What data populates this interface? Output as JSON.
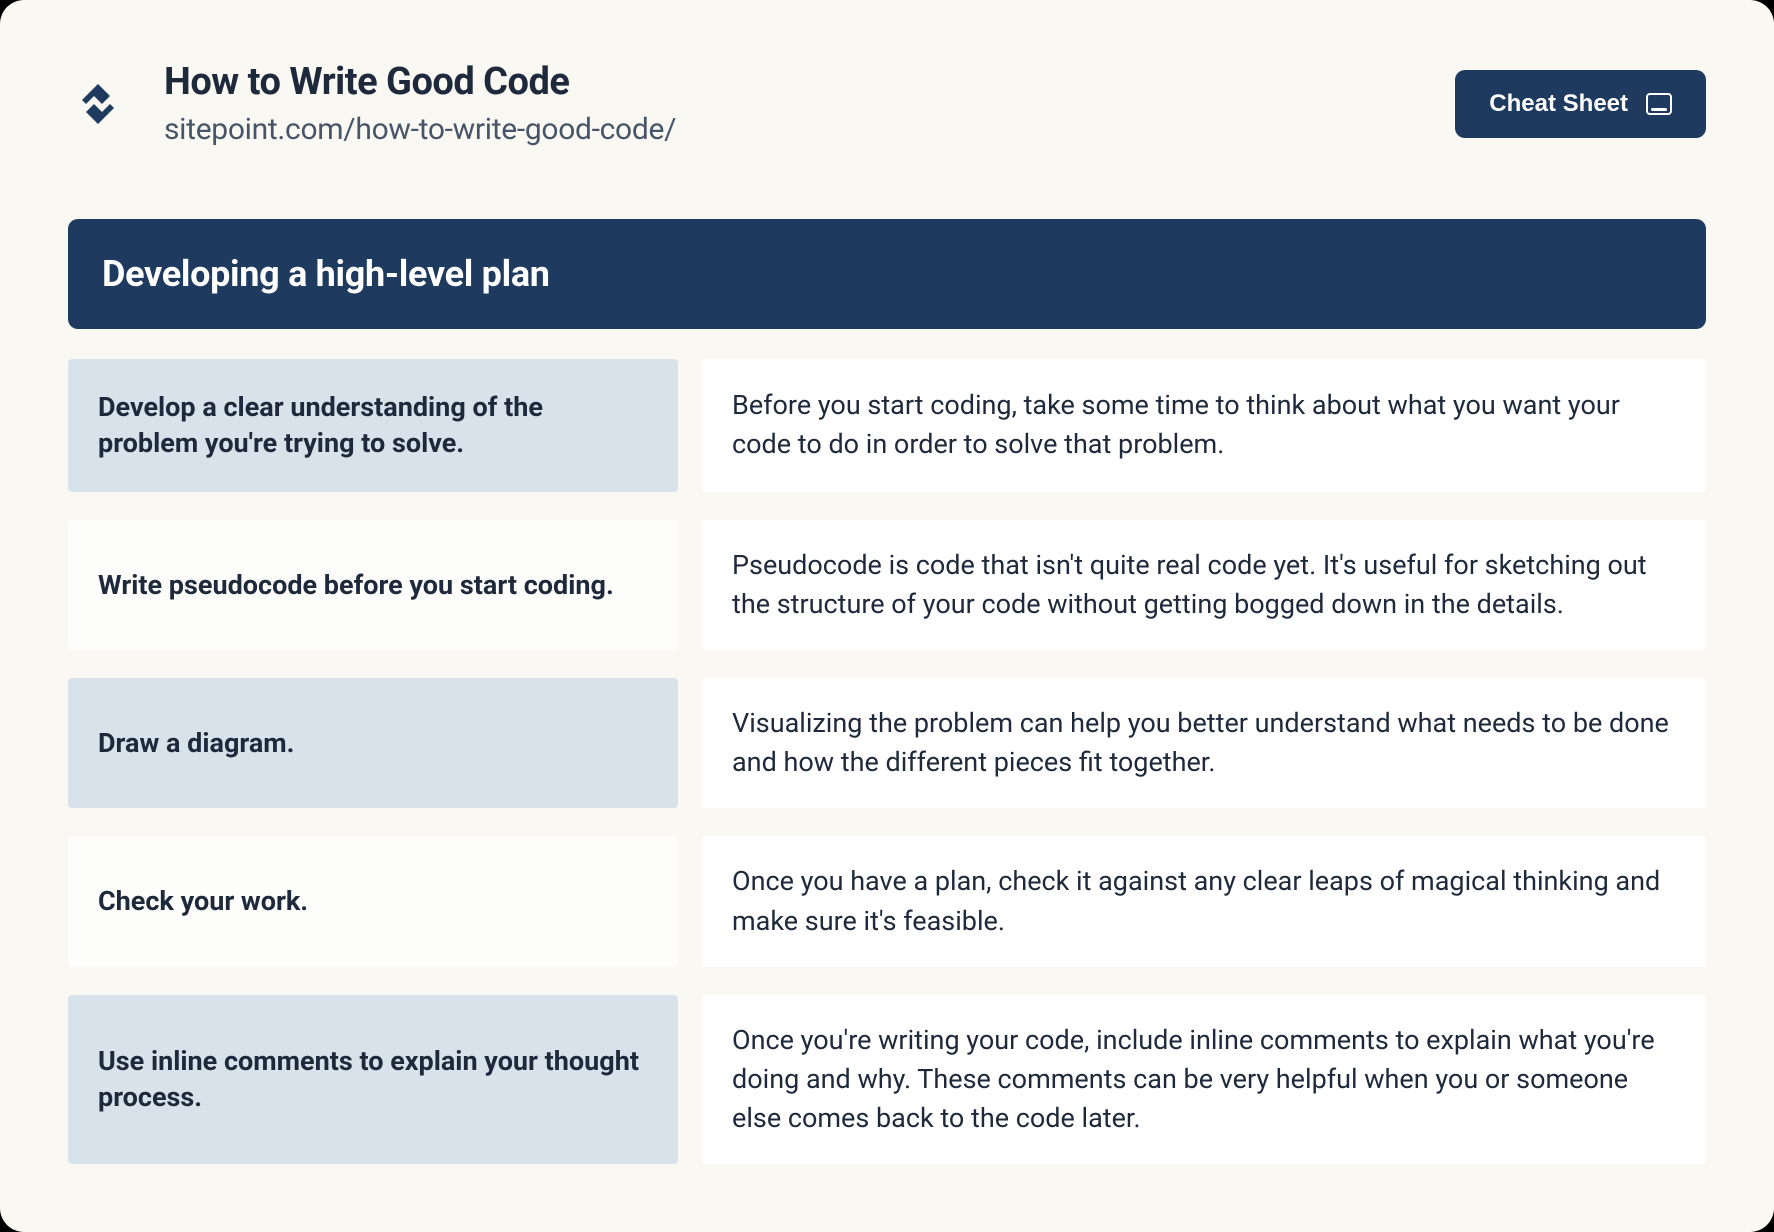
{
  "header": {
    "title": "How to Write Good Code",
    "subtitle": "sitepoint.com/how-to-write-good-code/",
    "button_label": "Cheat Sheet"
  },
  "section": {
    "heading": "Developing a high-level plan",
    "rows": [
      {
        "title": "Develop a clear understanding of the problem you're trying to solve.",
        "desc": "Before you start coding, take some time to think about what you want your code to do in order to solve that problem."
      },
      {
        "title": "Write pseudocode before you start coding.",
        "desc": "Pseudocode is code that isn't quite real code yet. It's useful for sketching out the structure of your code without getting bogged down in the details."
      },
      {
        "title": "Draw a diagram.",
        "desc": "Visualizing the problem can help you better understand what needs to be done and how the different pieces fit together."
      },
      {
        "title": "Check your work.",
        "desc": "Once you have a plan, check it against any clear leaps of magical thinking and make sure it's feasible."
      },
      {
        "title": "Use inline comments to explain your thought process.",
        "desc": "Once you're writing your code, include inline comments to explain what you're doing and why. These comments can be very helpful when you or someone else comes back to the code later."
      }
    ]
  }
}
